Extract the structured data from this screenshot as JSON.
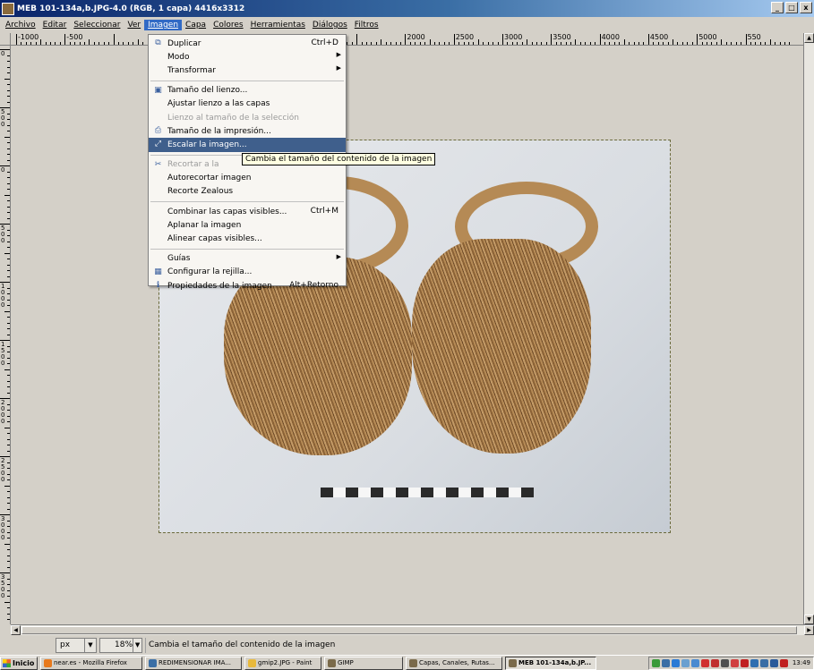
{
  "window": {
    "title": "MEB 101-134a,b.JPG-4.0 (RGB, 1 capa) 4416x3312",
    "controls": [
      "_",
      "□",
      "x"
    ]
  },
  "menubar": [
    "Archivo",
    "Editar",
    "Seleccionar",
    "Ver",
    "Imagen",
    "Capa",
    "Colores",
    "Herramientas",
    "Diálogos",
    "Filtros"
  ],
  "menubar_active": "Imagen",
  "ruler": {
    "h_labels": [
      "-1000",
      "-500",
      "",
      "",
      "",
      "",
      "",
      "",
      "2000",
      "2500",
      "3000",
      "3500",
      "4000",
      "4500",
      "5000",
      "550"
    ],
    "v_labels": [
      "0",
      "500",
      "0",
      "500",
      "1000",
      "1500",
      "2000",
      "2500",
      "3000",
      "3500",
      "4"
    ]
  },
  "dropdown": {
    "items": [
      {
        "label": "Duplicar",
        "shortcut": "Ctrl+D",
        "icon": "duplicate-icon"
      },
      {
        "label": "Modo",
        "submenu": true
      },
      {
        "label": "Transformar",
        "submenu": true
      },
      {
        "sep": true
      },
      {
        "label": "Tamaño del lienzo...",
        "icon": "canvas-size-icon"
      },
      {
        "label": "Ajustar lienzo a las capas"
      },
      {
        "label": "Lienzo al tamaño de la selección",
        "disabled": true
      },
      {
        "label": "Tamaño de la impresión...",
        "icon": "print-size-icon"
      },
      {
        "label": "Escalar la imagen...",
        "icon": "scale-image-icon",
        "highlight": true
      },
      {
        "sep": true
      },
      {
        "label": "Recortar a la",
        "icon": "crop-icon",
        "disabled": true
      },
      {
        "label": "Autorecortar imagen"
      },
      {
        "label": "Recorte Zealous"
      },
      {
        "sep": true
      },
      {
        "label": "Combinar las capas visibles...",
        "shortcut": "Ctrl+M"
      },
      {
        "label": "Aplanar la imagen"
      },
      {
        "label": "Alinear capas visibles..."
      },
      {
        "sep": true
      },
      {
        "label": "Guías",
        "submenu": true
      },
      {
        "label": "Configurar la rejilla...",
        "icon": "grid-icon"
      },
      {
        "label": "Propiedades de la imagen",
        "shortcut": "Alt+Retorno",
        "icon": "info-icon"
      }
    ]
  },
  "tooltip": "Cambia el tamaño del contenido de la imagen",
  "statusbar": {
    "unit": "px",
    "zoom": "18%",
    "message": "Cambia el tamaño del contenido de la imagen"
  },
  "taskbar": {
    "start": "Inicio",
    "tasks": [
      {
        "label": "near.es - Mozilla Firefox",
        "color": "#e8791c"
      },
      {
        "label": "REDIMENSIONAR IMA...",
        "color": "#3a6ea5"
      },
      {
        "label": "gmip2.JPG - Paint",
        "color": "#e8b93c"
      },
      {
        "label": "GIMP",
        "color": "#7a6a4a"
      },
      {
        "label": "Capas, Canales, Rutas...",
        "color": "#7a6a4a"
      },
      {
        "label": "MEB 101-134a,b.JP...",
        "color": "#7a6a4a",
        "active": true
      }
    ],
    "tray_colors": [
      "#3a9a3a",
      "#3a6ea5",
      "#2a7ad5",
      "#6aa0d0",
      "#4a8ad0",
      "#d03030",
      "#c03030",
      "#505050",
      "#d04040",
      "#c02020",
      "#306fb0",
      "#3a6ea5",
      "#2a5a9a",
      "#c02020"
    ],
    "clock": "13:49"
  }
}
